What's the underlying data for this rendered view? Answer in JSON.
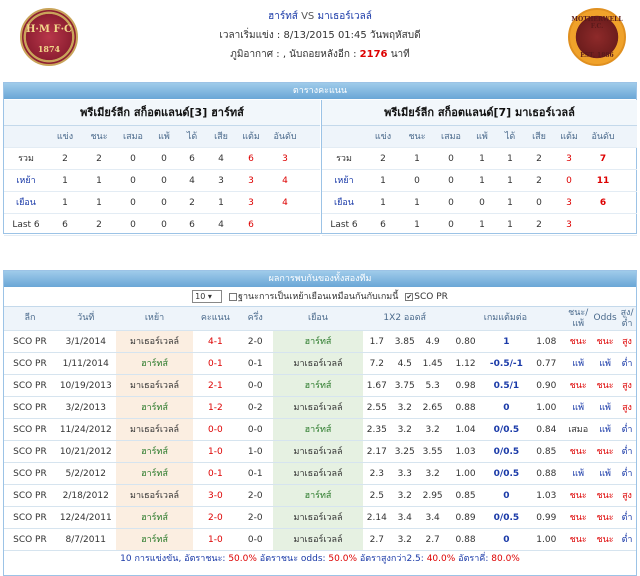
{
  "header": {
    "home_team": "ฮาร์ทส์",
    "vs": "VS",
    "away_team": "มาเธอร์เวลล์",
    "start_label": "เวลาเริ่มแข่ง :",
    "start_value": "8/13/2015 01:45 วันพฤหัสบดี",
    "weather_label": "ภูมิอากาศ :",
    "countdown_label": ", นับถอยหลังอีก :",
    "countdown_value": "2176",
    "countdown_unit": "นาที",
    "home_logo": {
      "initials": "H·M F·C",
      "year": "1874"
    },
    "away_logo": {
      "name": "MOTHERWELL F.C.",
      "year": "EST. 1886"
    }
  },
  "standings": {
    "title": "ตารางคะแนน",
    "columns": [
      "",
      "แข่ง",
      "ชนะ",
      "เสมอ",
      "แพ้",
      "ได้",
      "เสีย",
      "แต้ม",
      "อันดับ"
    ],
    "home": {
      "title": "พรีเมียร์ลีก สก็อตแลนด์[3]  ฮาร์ทส์",
      "rows": [
        [
          "รวม",
          "2",
          "2",
          "0",
          "0",
          "6",
          "4",
          "6",
          "3"
        ],
        [
          "เหย้า",
          "1",
          "1",
          "0",
          "0",
          "4",
          "3",
          "3",
          "4"
        ],
        [
          "เยือน",
          "1",
          "1",
          "0",
          "0",
          "2",
          "1",
          "3",
          "4"
        ],
        [
          "Last 6",
          "6",
          "2",
          "0",
          "0",
          "6",
          "4",
          "6",
          ""
        ]
      ]
    },
    "away": {
      "title": "พรีเมียร์ลีก สก็อตแลนด์[7]  มาเธอร์เวลล์",
      "rows": [
        [
          "รวม",
          "2",
          "1",
          "0",
          "1",
          "1",
          "2",
          "3",
          "7"
        ],
        [
          "เหย้า",
          "1",
          "0",
          "0",
          "1",
          "1",
          "2",
          "0",
          "11"
        ],
        [
          "เยือน",
          "1",
          "1",
          "0",
          "0",
          "1",
          "0",
          "3",
          "6"
        ],
        [
          "Last 6",
          "6",
          "1",
          "0",
          "1",
          "1",
          "2",
          "3",
          ""
        ]
      ]
    }
  },
  "h2h": {
    "title": "ผลการพบกันของทั้งสองทีม",
    "filter": {
      "count": "10",
      "base_label": "ฐานะการเป็นเหย้าเยือนเหมือนกันกับเกมนี้",
      "league_label": "SCO PR",
      "league_checked": "✔"
    },
    "columns": [
      "ลีก",
      "วันที่",
      "เหย้า",
      "คะแนน",
      "ครึ่ง",
      "เยือน",
      "1X2 ออดส์",
      "เกมแต้มต่อ",
      "ชนะ/แพ้",
      "Odds",
      "สูง/ต่ำ"
    ],
    "rows": [
      [
        "SCO PR",
        "3/1/2014",
        "มาเธอร์เวลล์",
        "4-1",
        "2-0",
        "ฮาร์ทส์",
        "1.7",
        "3.85",
        "4.9",
        "0.80",
        "1",
        "1.08",
        "ชนะ",
        "ชนะ",
        "สูง"
      ],
      [
        "SCO PR",
        "1/11/2014",
        "ฮาร์ทส์",
        "0-1",
        "0-1",
        "มาเธอร์เวลล์",
        "7.2",
        "4.5",
        "1.45",
        "1.12",
        "-0.5/-1",
        "0.77",
        "แพ้",
        "แพ้",
        "ต่ำ"
      ],
      [
        "SCO PR",
        "10/19/2013",
        "มาเธอร์เวลล์",
        "2-1",
        "0-0",
        "ฮาร์ทส์",
        "1.67",
        "3.75",
        "5.3",
        "0.98",
        "0.5/1",
        "0.90",
        "ชนะ",
        "ชนะ",
        "สูง"
      ],
      [
        "SCO PR",
        "3/2/2013",
        "ฮาร์ทส์",
        "1-2",
        "0-2",
        "มาเธอร์เวลล์",
        "2.55",
        "3.2",
        "2.65",
        "0.88",
        "0",
        "1.00",
        "แพ้",
        "แพ้",
        "สูง"
      ],
      [
        "SCO PR",
        "11/24/2012",
        "มาเธอร์เวลล์",
        "0-0",
        "0-0",
        "ฮาร์ทส์",
        "2.35",
        "3.2",
        "3.2",
        "1.04",
        "0/0.5",
        "0.84",
        "เสมอ",
        "แพ้",
        "ต่ำ"
      ],
      [
        "SCO PR",
        "10/21/2012",
        "ฮาร์ทส์",
        "1-0",
        "1-0",
        "มาเธอร์เวลล์",
        "2.17",
        "3.25",
        "3.55",
        "1.03",
        "0/0.5",
        "0.85",
        "ชนะ",
        "ชนะ",
        "ต่ำ"
      ],
      [
        "SCO PR",
        "5/2/2012",
        "ฮาร์ทส์",
        "0-1",
        "0-1",
        "มาเธอร์เวลล์",
        "2.3",
        "3.3",
        "3.2",
        "1.00",
        "0/0.5",
        "0.88",
        "แพ้",
        "แพ้",
        "ต่ำ"
      ],
      [
        "SCO PR",
        "2/18/2012",
        "มาเธอร์เวลล์",
        "3-0",
        "2-0",
        "ฮาร์ทส์",
        "2.5",
        "3.2",
        "2.95",
        "0.85",
        "0",
        "1.03",
        "ชนะ",
        "ชนะ",
        "สูง"
      ],
      [
        "SCO PR",
        "12/24/2011",
        "ฮาร์ทส์",
        "2-0",
        "2-0",
        "มาเธอร์เวลล์",
        "2.14",
        "3.4",
        "3.4",
        "0.89",
        "0/0.5",
        "0.99",
        "ชนะ",
        "ชนะ",
        "ต่ำ"
      ],
      [
        "SCO PR",
        "8/7/2011",
        "ฮาร์ทส์",
        "1-0",
        "0-0",
        "มาเธอร์เวลล์",
        "2.7",
        "3.2",
        "2.7",
        "0.88",
        "0",
        "1.00",
        "ชนะ",
        "ชนะ",
        "ต่ำ"
      ]
    ],
    "summary": {
      "count_label": "10 การแข่งขัน, อัตราชนะ:",
      "win_rate": "50.0%",
      "odds_label": "อัตราชนะ odds:",
      "odds_rate": "50.0%",
      "over_label": "อัตราสูงกว่า2.5:",
      "over_rate": "40.0%",
      "even_label": "อัตราคี่:",
      "even_rate": "80.0%"
    }
  }
}
